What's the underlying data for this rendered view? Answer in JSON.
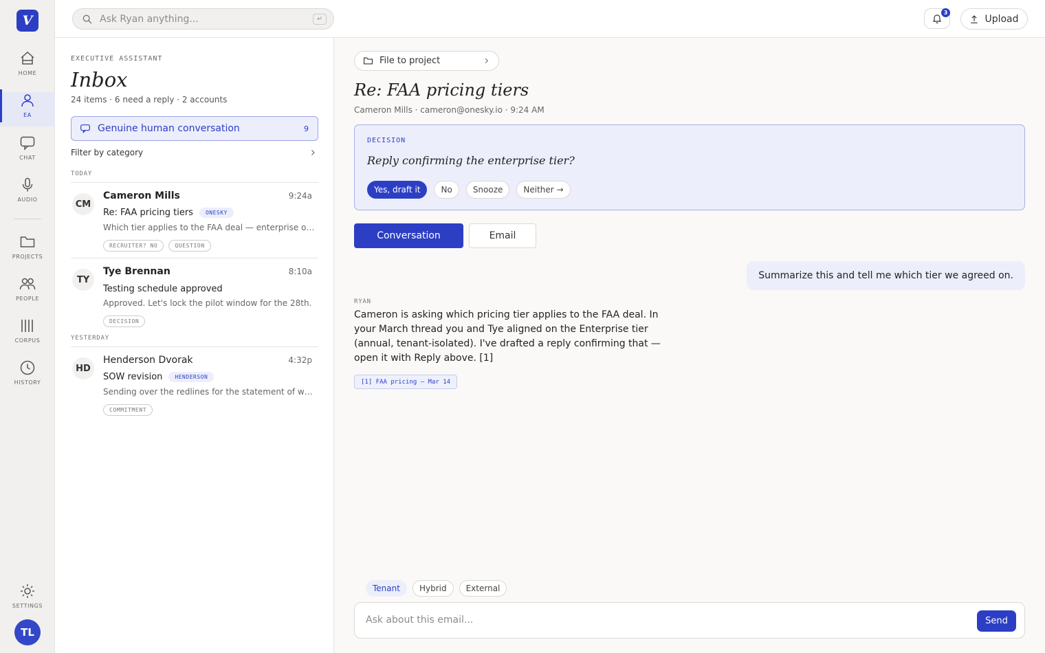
{
  "app": {
    "logo_letter": "V",
    "accent": "#2c3fc4"
  },
  "nav": {
    "items": [
      {
        "label": "HOME",
        "icon": "home-icon"
      },
      {
        "label": "EA",
        "icon": "person-icon",
        "active": true
      },
      {
        "label": "CHAT",
        "icon": "chat-icon"
      },
      {
        "label": "AUDIO",
        "icon": "microphone-icon"
      },
      {
        "label": "PROJECTS",
        "icon": "folder-icon"
      },
      {
        "label": "PEOPLE",
        "icon": "people-icon"
      },
      {
        "label": "CORPUS",
        "icon": "corpus-icon"
      },
      {
        "label": "HISTORY",
        "icon": "clock-icon"
      },
      {
        "label": "SETTINGS",
        "icon": "gear-icon"
      }
    ],
    "user_initials": "TL"
  },
  "topbar": {
    "search_placeholder": "Ask Ryan anything...",
    "enter_hint": "↵",
    "notifications_count": "3",
    "upload_label": "Upload"
  },
  "inbox": {
    "eyebrow": "EXECUTIVE ASSISTANT",
    "title": "Inbox",
    "meta": "24 items · 6 need a reply · 2 accounts",
    "filter_label": "Genuine human conversation",
    "filter_count": "9",
    "filter_category_label": "Filter by category",
    "groups": {
      "today": "TODAY",
      "yesterday": "YESTERDAY"
    },
    "rows": [
      {
        "initials": "CM",
        "name": "Cameron Mills",
        "time": "9:24a",
        "subject": "Re: FAA pricing tiers",
        "account": "ONESKY",
        "preview": "Which tier applies to the FAA deal — enterprise or hybrid?",
        "tags": [
          "RECRUITER? NO",
          "QUESTION"
        ]
      },
      {
        "initials": "TY",
        "name": "Tye Brennan",
        "time": "8:10a",
        "subject": "Testing schedule approved",
        "preview": "Approved. Let's lock the pilot window for the 28th.",
        "tags": [
          "DECISION"
        ]
      },
      {
        "initials": "HD",
        "name": "Henderson Dvorak",
        "time": "4:32p",
        "subject": "SOW revision",
        "account": "HENDERSON",
        "preview": "Sending over the redlines for the statement of work.",
        "tags": [
          "COMMITMENT"
        ]
      }
    ]
  },
  "detail": {
    "file_to_project": "File to project",
    "subject": "Re: FAA pricing tiers",
    "from": "Cameron Mills · cameron@onesky.io · 9:24 AM",
    "decision": {
      "kicker": "DECISION",
      "question": "Reply confirming the enterprise tier?",
      "options": [
        "Yes, draft it",
        "No",
        "Snooze",
        "Neither →"
      ]
    },
    "tabs": [
      "Conversation",
      "Email"
    ],
    "user_message": "Summarize this and tell me which tier we agreed on.",
    "assistant_name": "RYAN",
    "assistant_message": "Cameron is asking which pricing tier applies to the FAA deal. In your March thread you and Tye aligned on the Enterprise tier (annual, tenant-isolated). I've drafted a reply confirming that — open it with Reply above. [1]",
    "citation": "[1] FAA pricing — Mar 14",
    "scopes": [
      "Tenant",
      "Hybrid",
      "External"
    ],
    "composer_placeholder": "Ask about this email...",
    "send_label": "Send"
  }
}
